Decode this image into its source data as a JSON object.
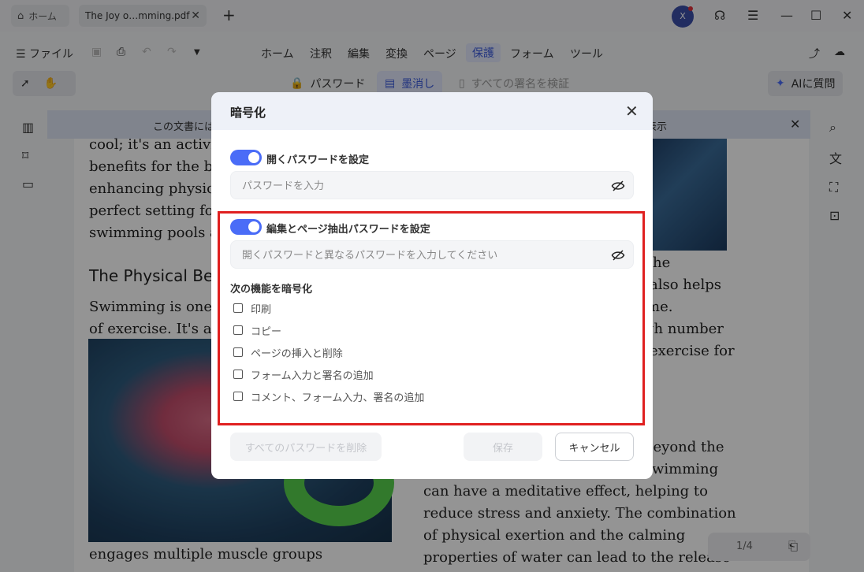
{
  "tabs": {
    "home_label": "ホーム",
    "doc_label": "The Joy o…mming.pdf"
  },
  "user": {
    "avatar_letter": "X"
  },
  "menubar": {
    "file_label": "ファイル",
    "items": [
      "ホーム",
      "注釈",
      "編集",
      "変換",
      "ページ",
      "保護",
      "フォーム",
      "ツール"
    ],
    "active": "保護"
  },
  "toolbar": {
    "password_label": "パスワード",
    "redact_label": "墨消し",
    "verify_label": "すべての署名を検証",
    "ai_label": "AIに質問"
  },
  "notice": {
    "text_left": "この文書には",
    "text_right": "表示"
  },
  "document": {
    "para1": [
      "cool; it's an activity",
      "benefits for the bo",
      "enhancing physica",
      "perfect setting for",
      "swimming pools a"
    ],
    "heading": "The Physical Ben",
    "para2": [
      "Swimming is one o",
      "of exercise. It's a fu"
    ],
    "right_col": [
      "he",
      "also helps",
      "me.",
      "gh number",
      "exercise for"
    ],
    "right_col2": [
      "beyond the",
      "wimming",
      "can have a meditative effect, helping to",
      "reduce stress and anxiety. The combination",
      "of physical exertion and the calming",
      "properties of water can lead to the release"
    ],
    "bottom_left": "engages multiple muscle groups"
  },
  "pager": {
    "text": "1/4"
  },
  "dialog": {
    "title": "暗号化",
    "open_password": {
      "label": "開くパスワードを設定",
      "placeholder": "パスワードを入力",
      "enabled": true
    },
    "edit_password": {
      "label": "編集とページ抽出パスワードを設定",
      "placeholder": "開くパスワードと異なるパスワードを入力してください",
      "enabled": true
    },
    "encrypt_heading": "次の機能を暗号化",
    "options": [
      "印刷",
      "コピー",
      "ページの挿入と削除",
      "フォーム入力と署名の追加",
      "コメント、フォーム入力、署名の追加"
    ],
    "buttons": {
      "remove_all": "すべてのパスワードを削除",
      "save": "保存",
      "cancel": "キャンセル"
    }
  },
  "colors": {
    "accent": "#4a6cf7",
    "highlight_border": "#e02020"
  }
}
